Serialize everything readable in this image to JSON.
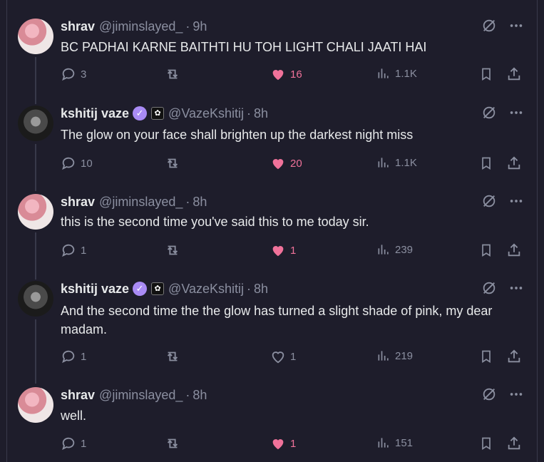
{
  "tweets": [
    {
      "name": "shrav",
      "handle": "@jiminslayed_",
      "time": "9h",
      "text": "BC PADHAI KARNE BAITHTI HU TOH LIGHT CHALI JAATI HAI",
      "replies": "3",
      "likes": "16",
      "liked": true,
      "views": "1.1K",
      "verified": false
    },
    {
      "name": "kshitij vaze",
      "handle": "@VazeKshitij",
      "time": "8h",
      "text": "The glow on your face shall brighten up the darkest night miss",
      "replies": "10",
      "likes": "20",
      "liked": true,
      "views": "1.1K",
      "verified": true
    },
    {
      "name": "shrav",
      "handle": "@jiminslayed_",
      "time": "8h",
      "text": "this is the second time you've said this to me today sir.",
      "replies": "1",
      "likes": "1",
      "liked": true,
      "views": "239",
      "verified": false
    },
    {
      "name": "kshitij vaze",
      "handle": "@VazeKshitij",
      "time": "8h",
      "text": "And the second time the the glow has turned a slight shade of pink, my dear madam.",
      "replies": "1",
      "likes": "1",
      "liked": false,
      "views": "219",
      "verified": true
    },
    {
      "name": "shrav",
      "handle": "@jiminslayed_",
      "time": "8h",
      "text": "well.",
      "replies": "1",
      "likes": "1",
      "liked": true,
      "views": "151",
      "verified": false
    }
  ],
  "separator": "·",
  "colors": {
    "background": "#1e1d2b",
    "like": "#f0729a",
    "muted": "#8b8fa0",
    "verified": "#a98bf5"
  },
  "icons": [
    "reply-icon",
    "retweet-icon",
    "heart-icon",
    "views-icon",
    "bookmark-icon",
    "share-icon",
    "grok-icon",
    "more-icon"
  ]
}
